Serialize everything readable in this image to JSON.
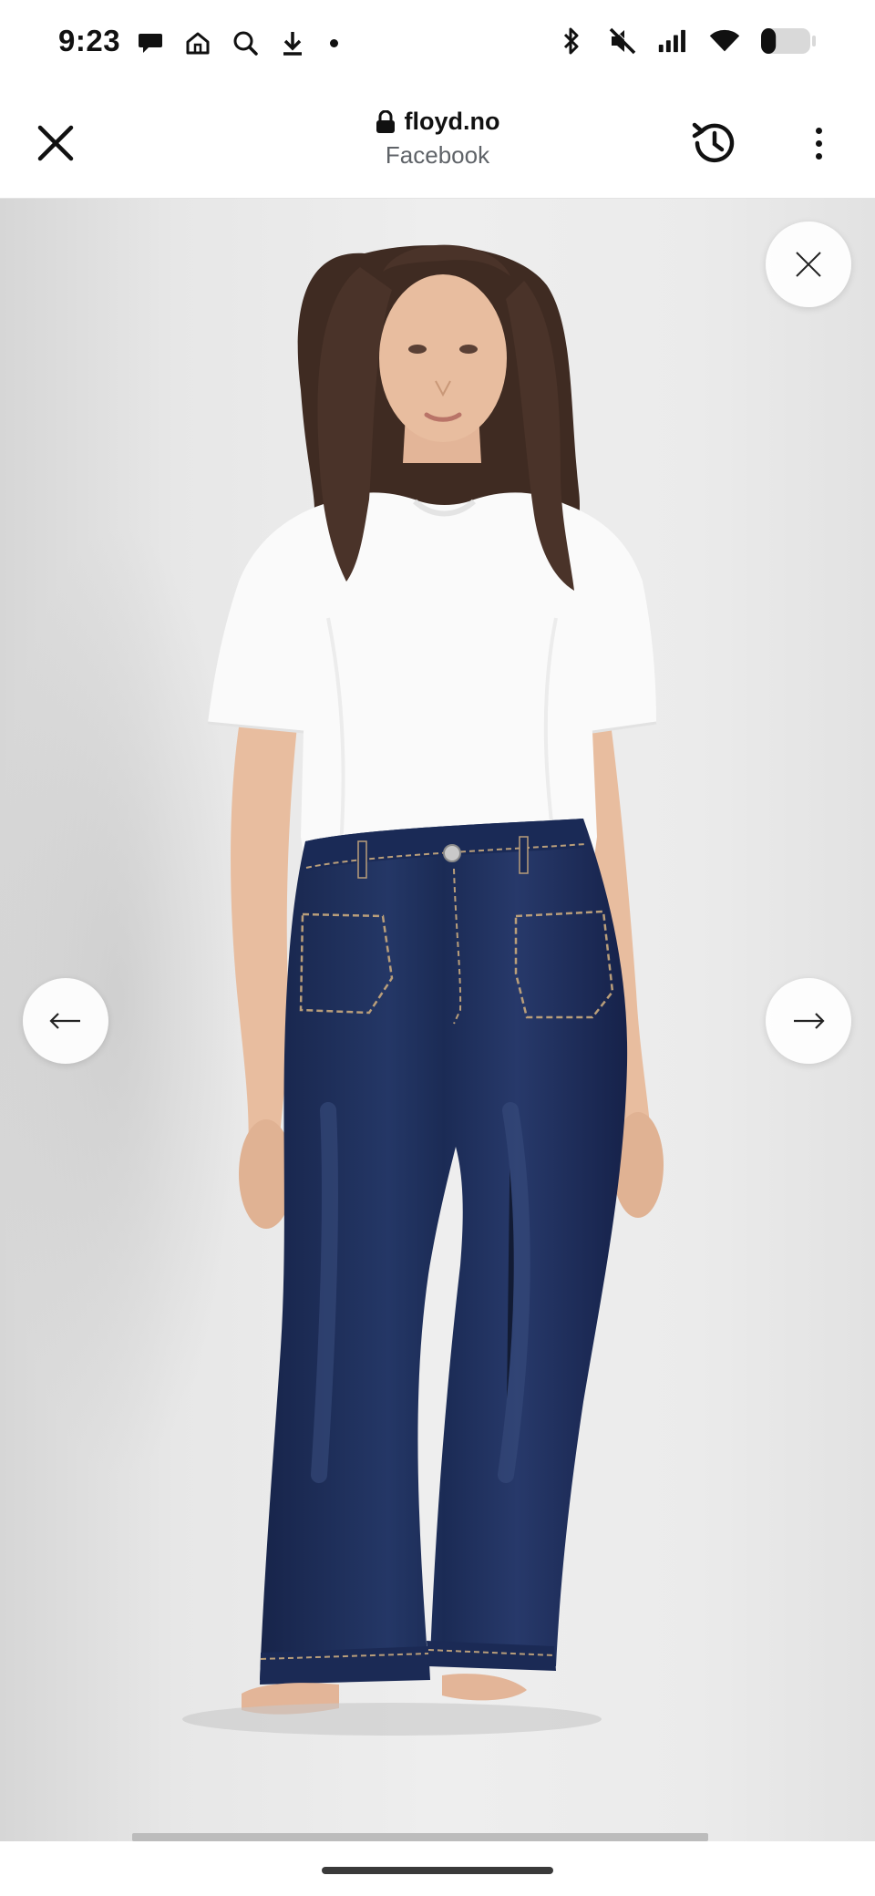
{
  "status_bar": {
    "time": "9:23",
    "left_icons": [
      "chat-bubble-icon",
      "home-icon",
      "search-icon",
      "download-icon",
      "dot-icon"
    ],
    "right_icons": [
      "bluetooth-icon",
      "mute-icon",
      "signal-icon",
      "wifi-icon",
      "battery-icon"
    ],
    "battery_level": 0.3
  },
  "browser": {
    "domain": "floyd.no",
    "subtitle": "Facebook",
    "close_icon": "close-icon",
    "lock_icon": "lock-icon",
    "history_icon": "history-icon",
    "menu_icon": "more-vertical-icon"
  },
  "viewer": {
    "image_subject": "product-photo",
    "close_icon": "close-icon",
    "prev_icon": "arrow-left-icon",
    "next_icon": "arrow-right-icon",
    "colors": {
      "background": "#ebebeb",
      "denim": "#1f2f5c",
      "shirt": "#fafafa",
      "skin": "#e8bd9f",
      "hair": "#4a3329"
    }
  }
}
